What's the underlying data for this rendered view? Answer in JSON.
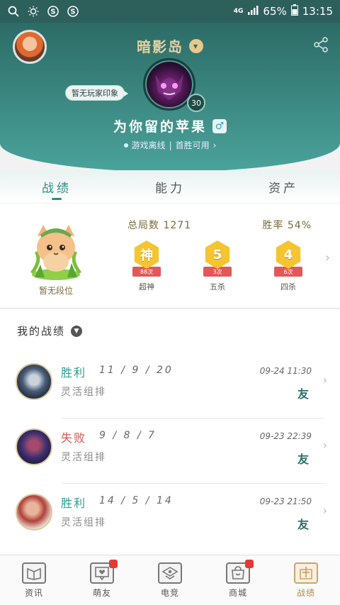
{
  "statusbar": {
    "network": "4G",
    "battery": "65%",
    "time": "13:15",
    "icons": [
      "search-icon",
      "brightness-icon",
      "s-circle-icon",
      "s-circle-icon"
    ]
  },
  "header": {
    "server_name": "暗影岛",
    "impression": "暂无玩家印象",
    "level": "30",
    "nickname": "为你留的苹果",
    "gender_symbol": "♂",
    "online_status": "游戏离线",
    "first_win": "首胜可用",
    "separator": "|"
  },
  "tabs": [
    {
      "label": "战绩",
      "active": true
    },
    {
      "label": "能力",
      "active": false
    },
    {
      "label": "资产",
      "active": false
    }
  ],
  "stats": {
    "rank_label": "暂无段位",
    "total_label": "总局数",
    "total_value": "1271",
    "winrate_label": "胜率",
    "winrate_value": "54%",
    "medals": [
      {
        "glyph": "神",
        "count": "88次",
        "name": "超神"
      },
      {
        "glyph": "5",
        "count": "3次",
        "name": "五杀"
      },
      {
        "glyph": "4",
        "count": "6次",
        "name": "四杀"
      }
    ]
  },
  "records": {
    "title": "我的战绩",
    "rows": [
      {
        "result": "胜利",
        "result_color": "#2b9c90",
        "kda": "11 / 9 / 20",
        "mode": "灵活组排",
        "time": "09-24 11:30",
        "tag": "友"
      },
      {
        "result": "失败",
        "result_color": "#d9534f",
        "kda": "9 / 8 / 7",
        "mode": "灵活组排",
        "time": "09-23 22:39",
        "tag": "友"
      },
      {
        "result": "胜利",
        "result_color": "#2b9c90",
        "kda": "14 / 5 / 14",
        "mode": "灵活组排",
        "time": "09-23 21:50",
        "tag": "友"
      }
    ]
  },
  "bottomnav": [
    {
      "label": "资讯",
      "icon": "news-icon",
      "badge": false,
      "active": false
    },
    {
      "label": "萌友",
      "icon": "friends-icon",
      "badge": true,
      "active": false
    },
    {
      "label": "电竞",
      "icon": "esports-icon",
      "badge": false,
      "active": false
    },
    {
      "label": "商城",
      "icon": "shop-icon",
      "badge": true,
      "active": false
    },
    {
      "label": "战绩",
      "icon": "record-icon",
      "badge": false,
      "active": true
    }
  ],
  "colors": {
    "header_dark": "#2d6b66",
    "header_light": "#4aa39b",
    "accent_teal": "#2b8d82",
    "win": "#2b9c90",
    "loss": "#d9534f",
    "gold": "#f4c431"
  }
}
